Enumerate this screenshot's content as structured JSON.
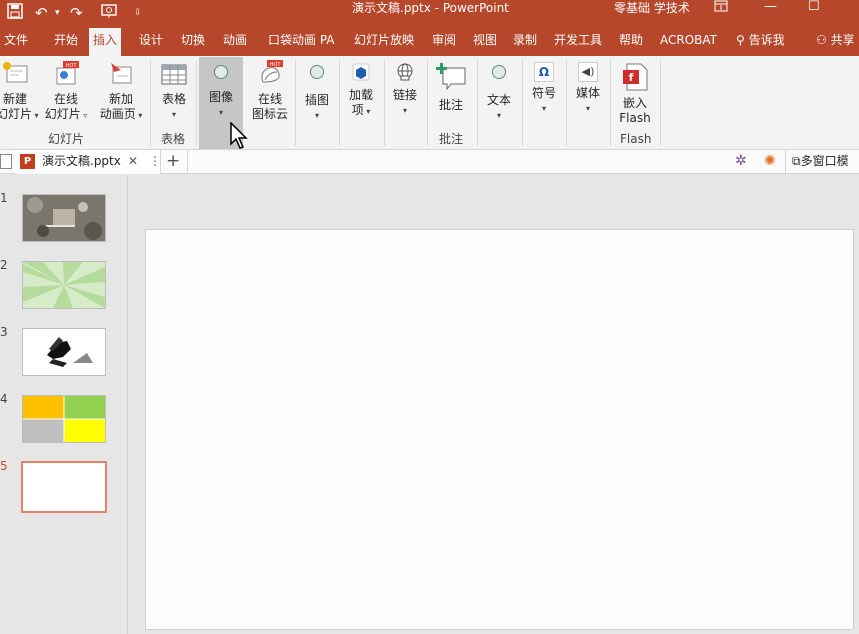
{
  "app": {
    "title": "演示文稿.pptx  -  PowerPoint",
    "user": "零基础 学技术",
    "restore_icon": "restore-icon",
    "minimize": "—",
    "maximize": "☐"
  },
  "tabs": [
    {
      "label": "文件"
    },
    {
      "label": "开始"
    },
    {
      "label": "插入"
    },
    {
      "label": "设计"
    },
    {
      "label": "切换"
    },
    {
      "label": "动画"
    },
    {
      "label": "口袋动画 PA"
    },
    {
      "label": "幻灯片放映"
    },
    {
      "label": "审阅"
    },
    {
      "label": "视图"
    },
    {
      "label": "录制"
    },
    {
      "label": "开发工具"
    },
    {
      "label": "帮助"
    },
    {
      "label": "ACROBAT"
    }
  ],
  "tell_me": "告诉我",
  "share": "共享",
  "ribbon": {
    "new_slide": [
      "新建",
      "幻灯片"
    ],
    "online_slide": [
      "在线",
      "幻灯片"
    ],
    "new_anim_page": [
      "新加",
      "动画页"
    ],
    "group_slides": "幻灯片",
    "table": "表格",
    "group_table": "表格",
    "image": "图像",
    "online_icons": [
      "在线",
      "图标云"
    ],
    "illustration": "插图",
    "addin": [
      "加载",
      "项"
    ],
    "link": "链接",
    "comment": "批注",
    "group_comment": "批注",
    "text": "文本",
    "symbol": "符号",
    "media": "媒体",
    "embed_flash": [
      "嵌入",
      "Flash"
    ],
    "group_flash": "Flash",
    "hot": "HOT"
  },
  "doc": {
    "tab_name": "演示文稿.pptx",
    "close": "✕",
    "more": "⋮",
    "add": "+",
    "multiwindow": "多窗口模"
  },
  "slides": [
    {
      "number": "1"
    },
    {
      "number": "2"
    },
    {
      "number": "3"
    },
    {
      "number": "4"
    },
    {
      "number": "5"
    }
  ],
  "colors": {
    "accent": "#b7472a",
    "slide4": [
      "#ffc000",
      "#92d050",
      "#bfbfbf",
      "#ffff00"
    ],
    "selected_border": "#e8826a"
  }
}
